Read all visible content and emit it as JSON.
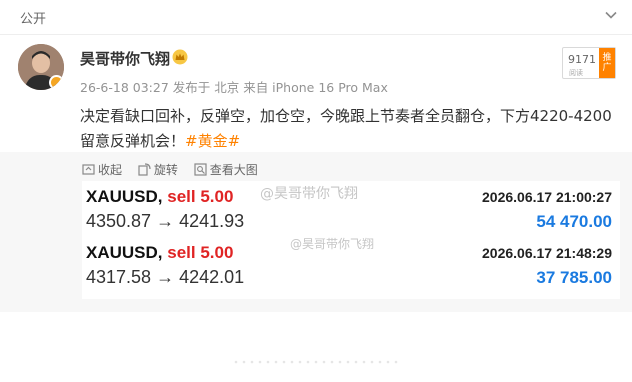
{
  "header": {
    "title": "公开",
    "chevron_icon": "chevron-down-icon"
  },
  "post": {
    "author": "昊哥带你飞翔",
    "meta": "26-6-18 03:27 发布于 北京 来自 iPhone 16 Pro Max",
    "hot_count": "9171",
    "hot_tag": "推广",
    "hot_sub": "阅读",
    "text": "决定看缺口回补，反弹空，加仓空，今晚跟上节奏者全员翻仓，下方4220-4200留意反弹机会！",
    "topic": "#黄金#"
  },
  "toolbar": {
    "collapse": "收起",
    "rotate": "旋转",
    "view_large": "查看大图"
  },
  "trades": [
    {
      "symbol": "XAUUSD,",
      "side": "sell 5.00",
      "datetime": "2026.06.17 21:00:27",
      "prices": "4350.87 → 4241.93",
      "profit": "54 470.00"
    },
    {
      "symbol": "XAUUSD,",
      "side": "sell 5.00",
      "datetime": "2026.06.17 21:48:29",
      "prices": "4317.58 → 4242.01",
      "profit": "37 785.00"
    }
  ],
  "watermarks": {
    "a": "@昊哥带你飞翔",
    "b": "@昊哥带你飞翔"
  },
  "colors": {
    "accent_orange": "#ff8200",
    "sell_red": "#e02424",
    "profit_blue": "#1a7ae0"
  }
}
